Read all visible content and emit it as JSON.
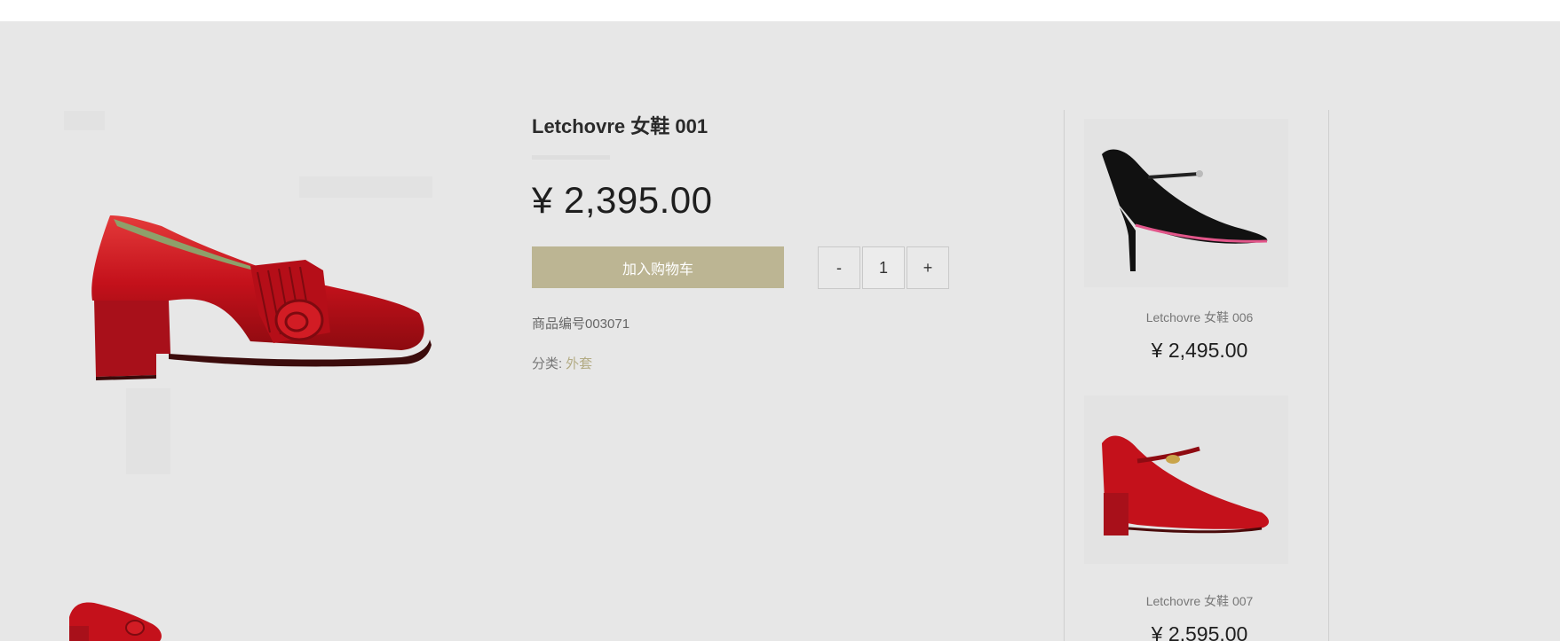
{
  "product": {
    "title": "Letchovre 女鞋 001",
    "price": "¥ 2,395.00",
    "add_to_cart_label": "加入购物车",
    "quantity": {
      "decrement_label": "-",
      "value": "1",
      "increment_label": "+"
    },
    "sku": "商品编号003071",
    "category_label": "分类:",
    "category_value": "外套",
    "main_image_icon": "red-patent-loafer-heel",
    "thumbnail_icon": "red-patent-loafer-heel"
  },
  "sidebar": {
    "items": [
      {
        "name": "Letchovre 女鞋 006",
        "price": "¥ 2,495.00",
        "icon": "black-lace-stiletto"
      },
      {
        "name": "Letchovre 女鞋 007",
        "price": "¥ 2,595.00",
        "icon": "red-mary-jane-heel"
      }
    ]
  },
  "colors": {
    "background": "#e7e7e7",
    "accent_button": "#bcb593",
    "category_link": "#b3ab84",
    "shoe_red": "#c4111b"
  }
}
